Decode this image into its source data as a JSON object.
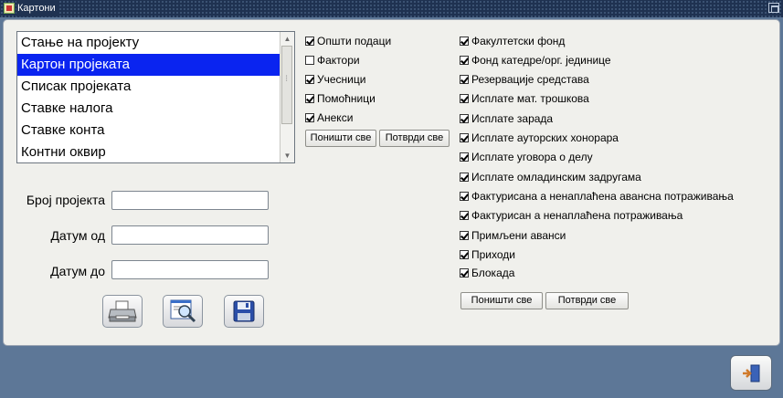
{
  "window": {
    "title": "Картони"
  },
  "report_list": {
    "items": [
      "Стање на пројекту",
      "Картон пројеката",
      "Списак пројеката",
      "Ставке налога",
      "Ставке конта",
      "Контни оквир"
    ],
    "selected_index": 1
  },
  "form": {
    "project_number_label": "Број пројекта",
    "project_number_value": "",
    "date_from_label": "Датум од",
    "date_from_value": "",
    "date_to_label": "Датум до",
    "date_to_value": ""
  },
  "toolbar": {
    "print_icon": "printer-icon",
    "preview_icon": "print-preview-icon",
    "save_icon": "floppy-disk-icon"
  },
  "left_options": {
    "items": [
      {
        "label": "Општи подаци",
        "checked": true
      },
      {
        "label": "Фактори",
        "checked": false
      },
      {
        "label": "Учесници",
        "checked": true
      },
      {
        "label": "Помоћници",
        "checked": true
      },
      {
        "label": "Анекси",
        "checked": true
      }
    ],
    "clear_all_label": "Поништи све",
    "select_all_label": "Потврди све"
  },
  "right_options": {
    "items": [
      {
        "label": "Факултетски фонд",
        "checked": true
      },
      {
        "label": "Фонд катедре/орг. јединице",
        "checked": true
      },
      {
        "label": "Резервације средстава",
        "checked": true
      },
      {
        "label": "Исплате мат. трошкова",
        "checked": true
      },
      {
        "label": "Исплате зарада",
        "checked": true
      },
      {
        "label": "Исплате ауторских хонорара",
        "checked": true
      },
      {
        "label": "Исплате уговора о делу",
        "checked": true
      },
      {
        "label": "Исплате омладинским задругама",
        "checked": true
      },
      {
        "label": "Фактурисана а ненаплаћена авансна потраживања",
        "checked": true
      },
      {
        "label": "Фактурисан а ненаплаћена потраживања",
        "checked": true
      },
      {
        "label": "Примљени аванси",
        "checked": true
      },
      {
        "label": "Приходи",
        "checked": true
      },
      {
        "label": "Блокада",
        "checked": true
      }
    ],
    "clear_all_label": "Поништи све",
    "select_all_label": "Потврди све"
  },
  "exit": {
    "icon": "exit-door-icon"
  },
  "colors": {
    "selection": "#0a24f0",
    "titlebar": "#1f3251",
    "desktop": "#5d7797",
    "panel": "#f0f0ec"
  }
}
